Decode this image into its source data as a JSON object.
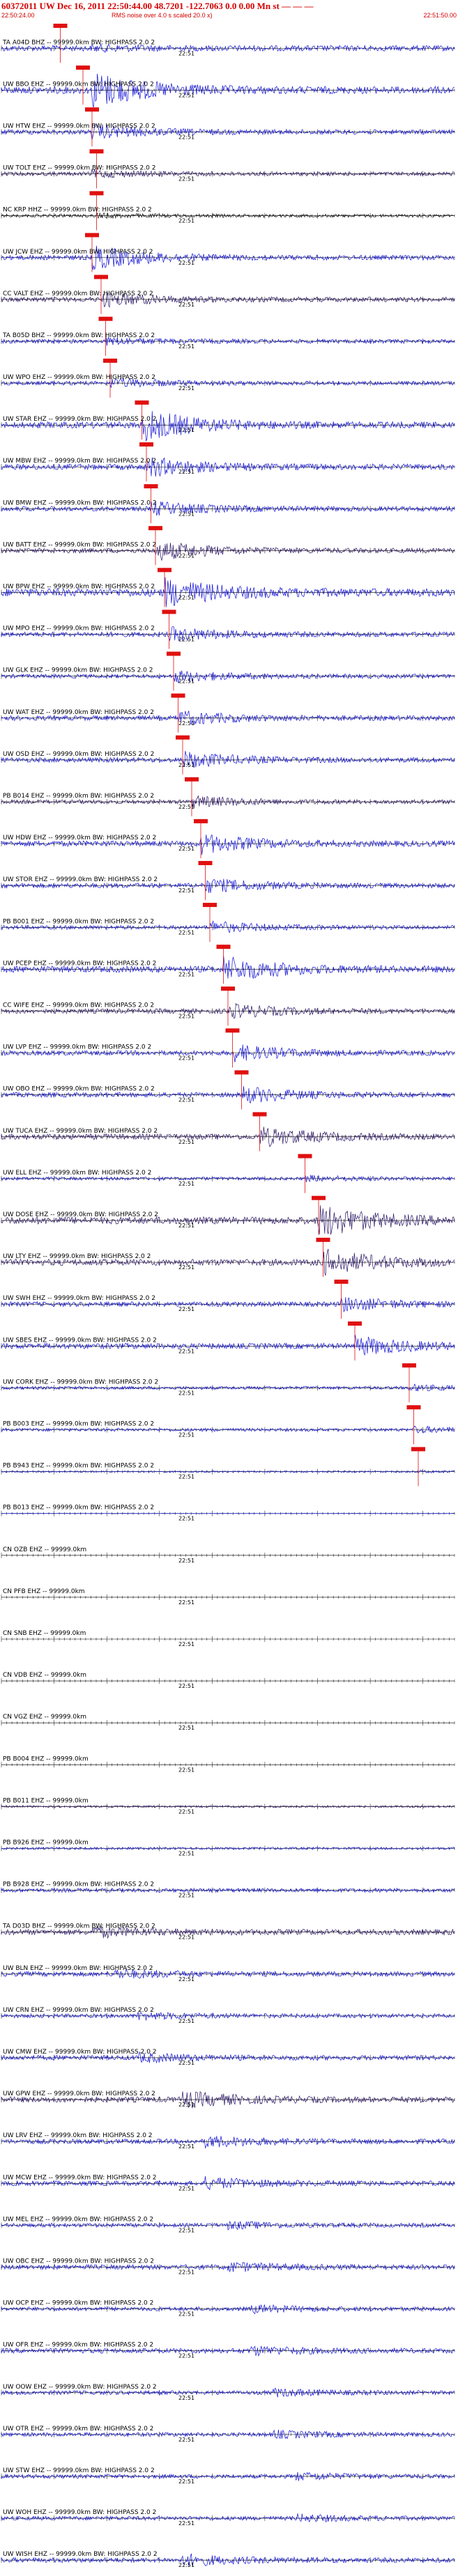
{
  "header": {
    "title": "60372011 UW Dec 16, 2011 22:50:44.00  48.7201 -122.7063  0.0 0.00 Mn st — — —",
    "start_time": "22:50:24.00",
    "note": "RMS noise over 4.0 s scaled 20.0 x)",
    "end_time": "22:51:50.00"
  },
  "colors": {
    "trace_blue": "#1010d8",
    "trace_dark": "#2a1466",
    "trace_black": "#111111",
    "pick_red": "#e01010",
    "axis": "#000000"
  },
  "chart_data": {
    "type": "seismogram",
    "time_tick_label": "22:51",
    "channels": [
      {
        "label": "TA A04D BHZ -- 99999.0km BW: HIGHPASS  2.0  2",
        "tick": "22:51",
        "color": "blue",
        "amp": 0.35,
        "onset": 0.2,
        "burst": 0.12,
        "pick": 0.13
      },
      {
        "label": "UW BBO EHZ -- 99999.0km BW: HIGHPASS  2.0  2",
        "tick": "22:51",
        "color": "blue",
        "amp": 0.45,
        "onset": 0.2,
        "burst": 0.9,
        "pick": 0.18
      },
      {
        "label": "UW HTW EHZ -- 99999.0km BW: HIGHPASS  2.0  2",
        "tick": "22:51",
        "color": "blue",
        "amp": 0.3,
        "onset": 0.2,
        "burst": 0.5,
        "pick": 0.2
      },
      {
        "label": "UW TOLT EHZ -- 99999.0km BW: HIGHPASS  2.0  2",
        "tick": "22:51",
        "color": "dark",
        "amp": 0.25,
        "onset": 0.2,
        "burst": 0.3,
        "pick": 0.21
      },
      {
        "label": "NC KRP HHZ -- 99999.0km BW: HIGHPASS  2.0  2",
        "tick": "22:51",
        "color": "black",
        "amp": 0.2,
        "onset": 0.21,
        "burst": 0.2,
        "pick": 0.21
      },
      {
        "label": "UW JCW EHZ -- 99999.0km BW: HIGHPASS  2.0  2",
        "tick": "22:51",
        "color": "blue",
        "amp": 0.3,
        "onset": 0.2,
        "burst": 0.9,
        "pick": 0.2
      },
      {
        "label": "CC VALT EHZ -- 99999.0km BW: HIGHPASS  2.0  2",
        "tick": "22:51",
        "color": "dark",
        "amp": 0.3,
        "onset": 0.22,
        "burst": 0.5,
        "pick": 0.22
      },
      {
        "label": "TA B05D BHZ -- 99999.0km BW: HIGHPASS  2.0  2",
        "tick": "22:51",
        "color": "blue",
        "amp": 0.25,
        "onset": 0.23,
        "burst": 0.3,
        "pick": 0.23
      },
      {
        "label": "UW WPO EHZ -- 99999.0km BW: HIGHPASS  2.0  2",
        "tick": "22:51",
        "color": "blue",
        "amp": 0.25,
        "onset": 0.24,
        "burst": 0.4,
        "pick": 0.24
      },
      {
        "label": "UW STAR EHZ -- 99999.0km BW: HIGHPASS  2.0  2",
        "tick": "22:51",
        "color": "blue",
        "amp": 0.4,
        "onset": 0.31,
        "burst": 0.9,
        "pick": 0.31
      },
      {
        "label": "UW MBW EHZ -- 99999.0km BW: HIGHPASS  2.0  2",
        "tick": "22:51",
        "color": "blue",
        "amp": 0.35,
        "onset": 0.32,
        "burst": 0.6,
        "pick": 0.32
      },
      {
        "label": "UW BMW EHZ -- 99999.0km BW: HIGHPASS  2.0  2",
        "tick": "22:51",
        "color": "blue",
        "amp": 0.3,
        "onset": 0.33,
        "burst": 0.5,
        "pick": 0.33
      },
      {
        "label": "UW BATT EHZ -- 99999.0km BW: HIGHPASS  2.0  2",
        "tick": "22:51",
        "color": "dark",
        "amp": 0.3,
        "onset": 0.34,
        "burst": 0.7,
        "pick": 0.34
      },
      {
        "label": "UW BPW EHZ -- 99999.0km BW: HIGHPASS  2.0  2",
        "tick": "22:51",
        "color": "blue",
        "amp": 0.5,
        "onset": 0.36,
        "burst": 0.6,
        "pick": 0.36
      },
      {
        "label": "UW MPO EHZ -- 99999.0km BW: HIGHPASS  2.0  2",
        "tick": "22:51",
        "color": "blue",
        "amp": 0.3,
        "onset": 0.37,
        "burst": 0.5,
        "pick": 0.37
      },
      {
        "label": "UW GLK EHZ -- 99999.0km BW: HIGHPASS  2.0  2",
        "tick": "22:51",
        "color": "blue",
        "amp": 0.25,
        "onset": 0.38,
        "burst": 0.5,
        "pick": 0.38
      },
      {
        "label": "UW WAT EHZ -- 99999.0km BW: HIGHPASS  2.0  2",
        "tick": "22:51",
        "color": "blue",
        "amp": 0.3,
        "onset": 0.39,
        "burst": 0.5,
        "pick": 0.39
      },
      {
        "label": "UW OSD EHZ -- 99999.0km BW: HIGHPASS  2.0  2",
        "tick": "22:51",
        "color": "blue",
        "amp": 0.3,
        "onset": 0.4,
        "burst": 0.6,
        "pick": 0.4
      },
      {
        "label": "PB B014 EHZ -- 99999.0km BW: HIGHPASS  2.0  2",
        "tick": "22:51",
        "color": "dark",
        "amp": 0.25,
        "onset": 0.42,
        "burst": 0.5,
        "pick": 0.42
      },
      {
        "label": "UW HDW EHZ -- 99999.0km BW: HIGHPASS  2.0  2",
        "tick": "22:51",
        "color": "blue",
        "amp": 0.35,
        "onset": 0.44,
        "burst": 0.6,
        "pick": 0.44
      },
      {
        "label": "UW STOR EHZ -- 99999.0km BW: HIGHPASS  2.0  2",
        "tick": "22:51",
        "color": "blue",
        "amp": 0.3,
        "onset": 0.45,
        "burst": 0.5,
        "pick": 0.45
      },
      {
        "label": "PB B001 EHZ -- 99999.0km BW: HIGHPASS  2.0  2",
        "tick": "22:51",
        "color": "blue",
        "amp": 0.25,
        "onset": 0.46,
        "burst": 0.5,
        "pick": 0.46
      },
      {
        "label": "UW PCEP EHZ -- 99999.0km BW: HIGHPASS  2.0  2",
        "tick": "22:51",
        "color": "blue",
        "amp": 0.4,
        "onset": 0.49,
        "burst": 0.7,
        "pick": 0.49
      },
      {
        "label": "CC WIFE EHZ -- 99999.0km BW: HIGHPASS  2.0  2",
        "tick": "22:51",
        "color": "dark",
        "amp": 0.3,
        "onset": 0.5,
        "burst": 0.5,
        "pick": 0.5
      },
      {
        "label": "UW LVP EHZ -- 99999.0km BW: HIGHPASS  2.0  2",
        "tick": "22:51",
        "color": "blue",
        "amp": 0.3,
        "onset": 0.51,
        "burst": 0.6,
        "pick": 0.51
      },
      {
        "label": "UW OBO EHZ -- 99999.0km BW: HIGHPASS  2.0  2",
        "tick": "22:51",
        "color": "blue",
        "amp": 0.3,
        "onset": 0.53,
        "burst": 0.6,
        "pick": 0.53
      },
      {
        "label": "UW TUCA EHZ -- 99999.0km BW: HIGHPASS  2.0  2",
        "tick": "22:51",
        "color": "dark",
        "amp": 0.35,
        "onset": 0.57,
        "burst": 0.6,
        "pick": 0.57
      },
      {
        "label": "UW ELL EHZ -- 99999.0km BW: HIGHPASS  2.0  2",
        "tick": "22:51",
        "color": "blue",
        "amp": 0.2,
        "onset": 0.67,
        "burst": 0.3,
        "pick": 0.67
      },
      {
        "label": "UW DOSE EHZ -- 99999.0km BW: HIGHPASS  2.0  2",
        "tick": "22:51",
        "color": "dark",
        "amp": 0.45,
        "onset": 0.7,
        "burst": 0.8,
        "pick": 0.7
      },
      {
        "label": "UW LTY EHZ -- 99999.0km BW: HIGHPASS  2.0  2",
        "tick": "22:51",
        "color": "dark",
        "amp": 0.4,
        "onset": 0.71,
        "burst": 0.7,
        "pick": 0.71
      },
      {
        "label": "UW SWH EHZ -- 99999.0km BW: HIGHPASS  2.0  2",
        "tick": "22:51",
        "color": "blue",
        "amp": 0.3,
        "onset": 0.75,
        "burst": 0.5,
        "pick": 0.75
      },
      {
        "label": "UW SBES EHZ -- 99999.0km BW: HIGHPASS  2.0  2",
        "tick": "22:51",
        "color": "blue",
        "amp": 0.35,
        "onset": 0.78,
        "burst": 0.6,
        "pick": 0.78
      },
      {
        "label": "UW CORK EHZ -- 99999.0km BW: HIGHPASS  2.0  2",
        "tick": "22:51",
        "color": "blue",
        "amp": 0.2,
        "onset": 0.9,
        "burst": 0.3,
        "pick": 0.9
      },
      {
        "label": "PB B003 EHZ -- 99999.0km BW: HIGHPASS  2.0  2",
        "tick": "22:51",
        "color": "blue",
        "amp": 0.2,
        "onset": 0.91,
        "burst": 0.3,
        "pick": 0.91
      },
      {
        "label": "PB B943 EHZ -- 99999.0km BW: HIGHPASS  2.0  2",
        "tick": "22:51",
        "color": "blue",
        "amp": 0.1,
        "onset": 0.92,
        "burst": 0.2,
        "pick": 0.92
      },
      {
        "label": "PB B013 EHZ -- 99999.0km BW: HIGHPASS  2.0  2",
        "tick": "22:51",
        "color": "blue",
        "amp": 0.03,
        "onset": 1.2,
        "burst": 0,
        "pick": null
      },
      {
        "label": "CN OZB EHZ -- 99999.0km",
        "tick": "22:51",
        "color": "flat",
        "amp": 0,
        "onset": 1.2,
        "burst": 0,
        "pick": null
      },
      {
        "label": "CN PFB EHZ -- 99999.0km",
        "tick": "22:51",
        "color": "flat",
        "amp": 0,
        "onset": 1.2,
        "burst": 0,
        "pick": null
      },
      {
        "label": "CN SNB EHZ -- 99999.0km",
        "tick": "22:51",
        "color": "flat",
        "amp": 0,
        "onset": 1.2,
        "burst": 0,
        "pick": null
      },
      {
        "label": "CN VDB EHZ -- 99999.0km",
        "tick": "22:51",
        "color": "flat",
        "amp": 0,
        "onset": 1.2,
        "burst": 0,
        "pick": null
      },
      {
        "label": "CN VGZ EHZ -- 99999.0km",
        "tick": "22:51",
        "color": "flat",
        "amp": 0,
        "onset": 1.2,
        "burst": 0,
        "pick": null
      },
      {
        "label": "PB B004 EHZ -- 99999.0km",
        "tick": "22:51",
        "color": "flat",
        "amp": 0,
        "onset": 1.2,
        "burst": 0,
        "pick": null
      },
      {
        "label": "PB B011 EHZ -- 99999.0km",
        "tick": "22:51",
        "color": "dark",
        "amp": 0.12,
        "onset": 1.2,
        "burst": 0,
        "pick": null
      },
      {
        "label": "PB B926 EHZ -- 99999.0km",
        "tick": "22:51",
        "color": "blue",
        "amp": 0.15,
        "onset": 1.2,
        "burst": 0,
        "pick": null
      },
      {
        "label": "PB B928 EHZ -- 99999.0km BW: HIGHPASS  2.0  2",
        "tick": "22:51",
        "color": "blue",
        "amp": 0.25,
        "onset": 1.2,
        "burst": 0,
        "pick": null
      },
      {
        "label": "TA D03D BHZ -- 99999.0km BW: HIGHPASS  2.0  2",
        "tick": "22:51",
        "color": "dark",
        "amp": 0.35,
        "onset": 0.2,
        "burst": 0.3,
        "pick": null
      },
      {
        "label": "UW BLN EHZ -- 99999.0km BW: HIGHPASS  2.0  2",
        "tick": "22:51",
        "color": "blue",
        "amp": 0.3,
        "onset": 0.25,
        "burst": 0.3,
        "pick": null
      },
      {
        "label": "UW CRN EHZ -- 99999.0km BW: HIGHPASS  2.0  2",
        "tick": "22:51",
        "color": "blue",
        "amp": 0.25,
        "onset": 0.3,
        "burst": 0.3,
        "pick": null
      },
      {
        "label": "UW CMW EHZ -- 99999.0km BW: HIGHPASS  2.0  2",
        "tick": "22:51",
        "color": "blue",
        "amp": 0.3,
        "onset": 0.3,
        "burst": 0.3,
        "pick": null
      },
      {
        "label": "UW GPW EHZ -- 99999.0km BW: HIGHPASS  2.0  2",
        "tick": "22:51",
        "color": "dark",
        "amp": 0.35,
        "onset": 0.4,
        "burst": 0.5,
        "pick": null
      },
      {
        "label": "UW LRV EHZ -- 99999.0km BW: HIGHPASS  2.0  2",
        "tick": "22:51",
        "color": "blue",
        "amp": 0.3,
        "onset": 0.45,
        "burst": 0.4,
        "pick": null
      },
      {
        "label": "UW MCW EHZ -- 99999.0km BW: HIGHPASS  2.0  2",
        "tick": "22:51",
        "color": "blue",
        "amp": 0.3,
        "onset": 0.45,
        "burst": 0.4,
        "pick": null
      },
      {
        "label": "UW MEL EHZ -- 99999.0km BW: HIGHPASS  2.0  2",
        "tick": "22:51",
        "color": "blue",
        "amp": 0.25,
        "onset": 0.5,
        "burst": 0.3,
        "pick": null
      },
      {
        "label": "UW OBC EHZ -- 99999.0km BW: HIGHPASS  2.0  2",
        "tick": "22:51",
        "color": "blue",
        "amp": 0.3,
        "onset": 0.5,
        "burst": 0.3,
        "pick": null
      },
      {
        "label": "UW OCP EHZ -- 99999.0km BW: HIGHPASS  2.0  2",
        "tick": "22:51",
        "color": "blue",
        "amp": 0.25,
        "onset": 0.55,
        "burst": 0.3,
        "pick": null
      },
      {
        "label": "UW OFR EHZ -- 99999.0km BW: HIGHPASS  2.0  2",
        "tick": "22:51",
        "color": "blue",
        "amp": 0.3,
        "onset": 0.55,
        "burst": 0.3,
        "pick": null
      },
      {
        "label": "UW OOW EHZ -- 99999.0km BW: HIGHPASS  2.0  2",
        "tick": "22:51",
        "color": "blue",
        "amp": 0.25,
        "onset": 0.6,
        "burst": 0.3,
        "pick": null
      },
      {
        "label": "UW OTR EHZ -- 99999.0km BW: HIGHPASS  2.0  2",
        "tick": "22:51",
        "color": "blue",
        "amp": 0.25,
        "onset": 0.6,
        "burst": 0.3,
        "pick": null
      },
      {
        "label": "UW STW EHZ -- 99999.0km BW: HIGHPASS  2.0  2",
        "tick": "22:51",
        "color": "blue",
        "amp": 0.25,
        "onset": 0.65,
        "burst": 0.3,
        "pick": null
      },
      {
        "label": "UW WOH EHZ -- 99999.0km BW: HIGHPASS  2.0  2",
        "tick": "22:51",
        "color": "blue",
        "amp": 0.25,
        "onset": 0.65,
        "burst": 0.3,
        "pick": null
      },
      {
        "label": "UW WISH EHZ -- 99999.0km BW: HIGHPASS  2.0  2",
        "tick": "22:51",
        "color": "blue",
        "amp": 0.3,
        "onset": 0.4,
        "burst": 0.4,
        "pick": null
      }
    ]
  }
}
